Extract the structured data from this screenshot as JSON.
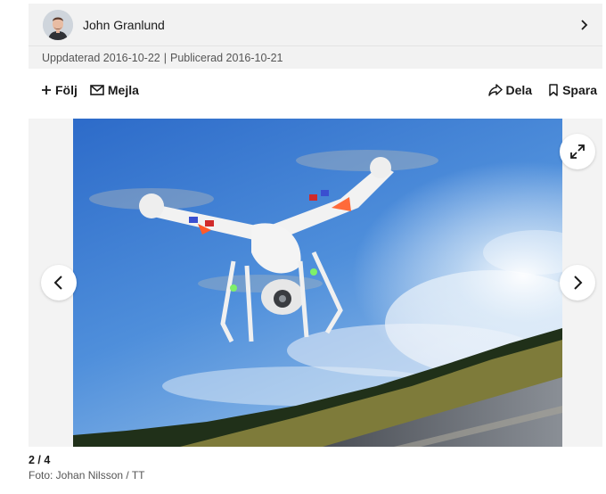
{
  "author": {
    "name": "John Granlund",
    "avatar_icon": "author-avatar"
  },
  "meta": {
    "updated": "Uppdaterad 2016-10-22",
    "separator": "|",
    "published": "Publicerad 2016-10-21"
  },
  "actions": {
    "follow_label": "Följ",
    "email_label": "Mejla",
    "share_label": "Dela",
    "save_label": "Spara"
  },
  "gallery": {
    "counter": "2 / 4",
    "credit": "Foto: Johan Nilsson / TT",
    "icons": {
      "prev": "chevron-left-icon",
      "next": "chevron-right-icon",
      "expand": "expand-icon"
    }
  },
  "colors": {
    "bar_background": "#f2f2f2",
    "gallery_background": "#f3f3f3",
    "text": "#1a1a1a",
    "muted_text": "#555555"
  }
}
